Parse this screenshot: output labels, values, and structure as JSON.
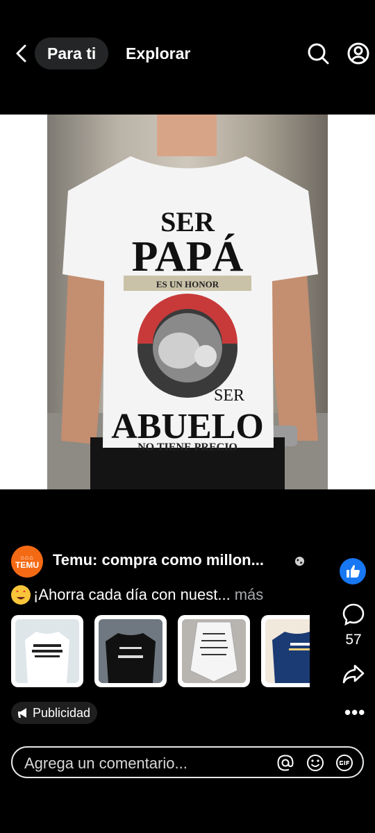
{
  "header": {
    "tab_active": "Para ti",
    "tab_other": "Explorar"
  },
  "post": {
    "page_name": "Temu: compra como millon...",
    "caption": "¡Ahorra cada día con nuest...",
    "more": "más",
    "brand_logo": "TEMU",
    "comment_count": "57",
    "badge": "Publicidad"
  },
  "shirt_print": {
    "line1": "SER",
    "line2": "PAPÁ",
    "ribbon": "ES UN HONOR",
    "line3": "SER",
    "line4": "ABUELO",
    "line5": "NO TIENE PRECIO"
  },
  "composer": {
    "placeholder": "Agrega un comentario..."
  },
  "colors": {
    "like_blue": "#1877f2",
    "brand_orange": "#f46a14",
    "pill_bg": "#242526"
  },
  "icons": [
    "back-icon",
    "search-icon",
    "profile-icon",
    "globe-icon",
    "like-icon",
    "comment-icon",
    "share-icon",
    "megaphone-icon",
    "more-icon",
    "at-icon",
    "emoji-icon",
    "gif-icon"
  ]
}
